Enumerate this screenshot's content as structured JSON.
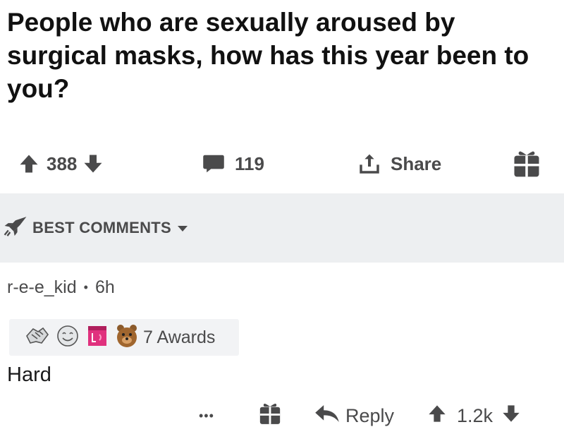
{
  "post": {
    "title": "People who are sexually aroused by surgical masks, how has this year been to you?"
  },
  "actions": {
    "score": "388",
    "comments": "119",
    "share_label": "Share"
  },
  "comments_section": {
    "sort_label": "BEST COMMENTS"
  },
  "comment": {
    "author": "r-e-e_kid",
    "separator": "•",
    "age": "6h",
    "awards_label": "7 Awards",
    "body": "Hard",
    "more_label": "•••",
    "reply_label": "Reply",
    "score": "1.2k"
  },
  "colors": {
    "icon_gray": "#4a4a4b",
    "bar_bg": "#edeff1",
    "award_bg": "#f2f3f5"
  },
  "icons": [
    "upvote-arrow-icon",
    "downvote-arrow-icon",
    "comment-bubble-icon",
    "share-icon",
    "gift-icon",
    "rocket-icon",
    "caret-down-icon",
    "award-icons",
    "reply-arrow-icon",
    "more-dots-icon"
  ]
}
